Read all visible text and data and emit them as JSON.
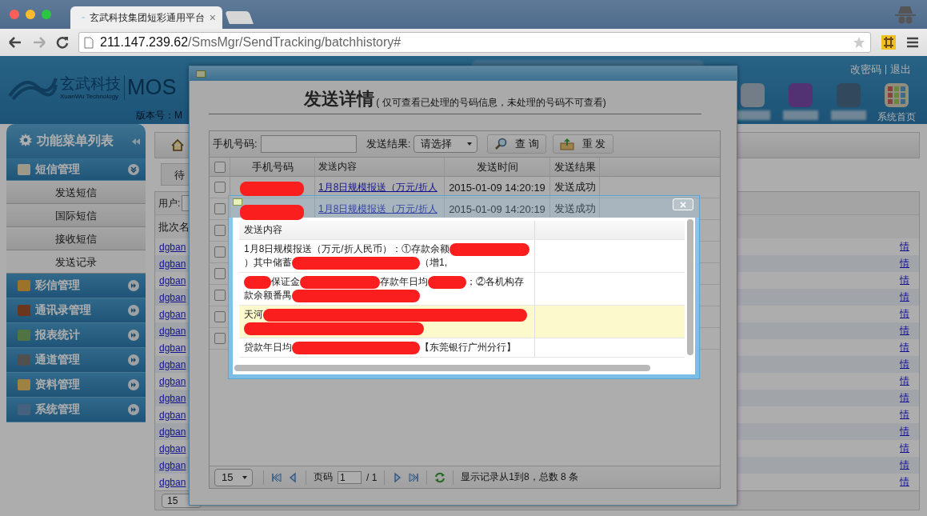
{
  "browser": {
    "tab_title": "玄武科技集团短彩通用平台",
    "tab_close": "×",
    "url_host": "211.147.239.62",
    "url_path": "/SmsMgr/SendTracking/batchhistory#"
  },
  "header": {
    "logo_cn": "玄武科技",
    "logo_en": "XuanWu Technology",
    "product": "MOS",
    "version_label": "版本号：M",
    "account_links": [
      "改密码",
      "退出"
    ],
    "nav": [
      {
        "kind": "blurred"
      },
      {
        "kind": "blurred"
      },
      {
        "kind": "blurred"
      },
      {
        "kind": "home",
        "label": "系统首页"
      }
    ]
  },
  "sidebar": {
    "title": "功能菜单列表",
    "groups": [
      {
        "label": "短信管理",
        "expanded": true,
        "children": [
          {
            "label": "发送短信",
            "selected": false
          },
          {
            "label": "国际短信",
            "selected": false
          },
          {
            "label": "接收短信",
            "selected": false
          },
          {
            "label": "发送记录",
            "selected": true
          }
        ]
      },
      {
        "label": "彩信管理",
        "expanded": false
      },
      {
        "label": "通讯录管理",
        "expanded": false
      },
      {
        "label": "报表统计",
        "expanded": false
      },
      {
        "label": "通道管理",
        "expanded": false
      },
      {
        "label": "资料管理",
        "expanded": false
      },
      {
        "label": "系统管理",
        "expanded": false
      }
    ]
  },
  "page": {
    "tab": "待",
    "user_label": "用户:",
    "column_1": "批次名",
    "page_size": "15",
    "rows": [
      {
        "link": "dgban",
        "link_2": "情"
      },
      {
        "link": "dgban",
        "link_2": "情"
      },
      {
        "link": "dgban",
        "link_2": "情"
      },
      {
        "link": "dgban",
        "link_2": "情"
      },
      {
        "link": "dgban",
        "link_2": "情"
      },
      {
        "link": "dgban",
        "link_2": "情"
      },
      {
        "link": "dgban",
        "link_2": "情"
      },
      {
        "link": "dgban",
        "link_2": "情"
      },
      {
        "link": "dgban",
        "link_2": "情"
      },
      {
        "link": "dgban",
        "link_2": "情"
      },
      {
        "link": "dgban",
        "link_2": "情"
      },
      {
        "link": "dgban",
        "link_2": "情"
      },
      {
        "link": "dgban",
        "link_2": "情"
      },
      {
        "link": "dgban",
        "link_2": "情"
      },
      {
        "link": "dgban",
        "link_2": "情"
      }
    ]
  },
  "dialog": {
    "title": "发送详情",
    "subtitle": "( 仅可查看已处理的号码信息，未处理的号码不可查看)",
    "phone_label": "手机号码:",
    "result_label": "发送结果:",
    "result_value": "请选择",
    "search_button": "查 询",
    "resend_button": "重 发",
    "select_all": {
      "checked": false
    },
    "columns": [
      "手机号码",
      "发送内容",
      "发送时间",
      "发送结果"
    ],
    "rows": [
      {
        "content": "1月8日规模报送（万元/折人",
        "time": "2015-01-09 14:20:19",
        "result": "发送成功",
        "checked": false
      },
      {
        "content": "1月8日规模报送（万元/折人",
        "time": "2015-01-09 14:20:19",
        "result": "发送成功",
        "checked": false
      },
      {
        "checked": false
      },
      {
        "checked": false
      },
      {
        "checked": false
      },
      {
        "checked": false
      },
      {
        "checked": false
      },
      {
        "checked": false
      }
    ],
    "pager": {
      "page_size": "15",
      "page_label": "页码",
      "page": "1",
      "total_pages": "/ 1",
      "summary": "显示记录从1到8，总数 8 条"
    }
  },
  "popup": {
    "close": "×",
    "column": "发送内容",
    "rows": [
      {
        "selected": false,
        "lines": [
          [
            {
              "kind": "text",
              "text": "1月8日规模报送（万元/折人民币）：①存款余额"
            },
            {
              "kind": "redaction"
            }
          ],
          [
            {
              "kind": "text",
              "text": "）其中储蓄"
            },
            {
              "kind": "longredaction"
            },
            {
              "kind": "text",
              "text": "（增1,"
            }
          ]
        ]
      },
      {
        "selected": false,
        "lines": [
          [
            {
              "kind": "tinyredaction"
            },
            {
              "kind": "text",
              "text": "保证金"
            },
            {
              "kind": "redaction"
            },
            {
              "kind": "text",
              "text": "存款年日均"
            },
            {
              "kind": "shortredaction"
            },
            {
              "kind": "text",
              "text": "；②各机构存"
            }
          ],
          [
            {
              "kind": "text",
              "text": "款余额番禺"
            },
            {
              "kind": "longredaction"
            }
          ]
        ]
      },
      {
        "selected": true,
        "lines": [
          [
            {
              "kind": "text",
              "text": "天河"
            },
            {
              "kind": "hugeredaction"
            }
          ],
          [
            {
              "kind": "wideredaction"
            }
          ]
        ]
      },
      {
        "selected": false,
        "lines": [
          [
            {
              "kind": "text",
              "text": "贷款年日均"
            },
            {
              "kind": "longredaction"
            },
            {
              "kind": "text",
              "text": "【东莞银行广州分行】"
            }
          ]
        ]
      }
    ]
  }
}
